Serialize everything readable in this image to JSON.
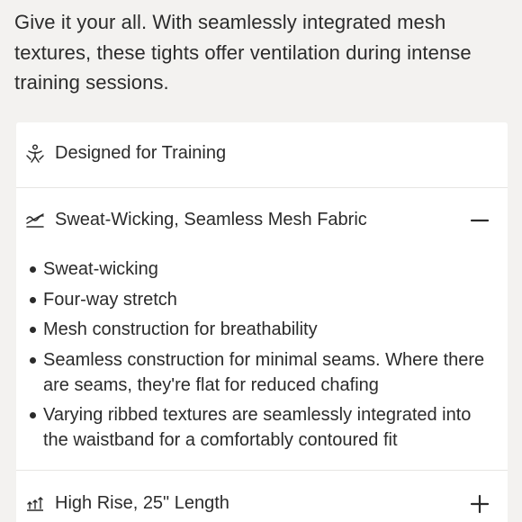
{
  "intro_text": "Give it your all. With seamlessly integrated mesh textures, these tights offer ventilation during intense training sessions.",
  "features": [
    {
      "icon": "training-figure-icon",
      "label": "Designed for Training"
    },
    {
      "icon": "fabric-wave-icon",
      "label": "Sweat-Wicking, Seamless Mesh Fabric",
      "toggle": "−",
      "expanded": true,
      "bullets": [
        "Sweat-wicking",
        "Four-way stretch",
        "Mesh construction for breathability",
        "Seamless construction for minimal seams. Where there are seams, they're flat for reduced chafing",
        "Varying ribbed textures are seamlessly integrated into the waistband for a comfortably contoured fit"
      ]
    },
    {
      "icon": "rise-length-icon",
      "label": "High Rise, 25\" Length",
      "toggle": "+",
      "expanded": false
    }
  ],
  "colors": {
    "background": "#f3f2f0",
    "card": "#ffffff",
    "text": "#2b2b2b",
    "divider": "#e6e5e3"
  }
}
